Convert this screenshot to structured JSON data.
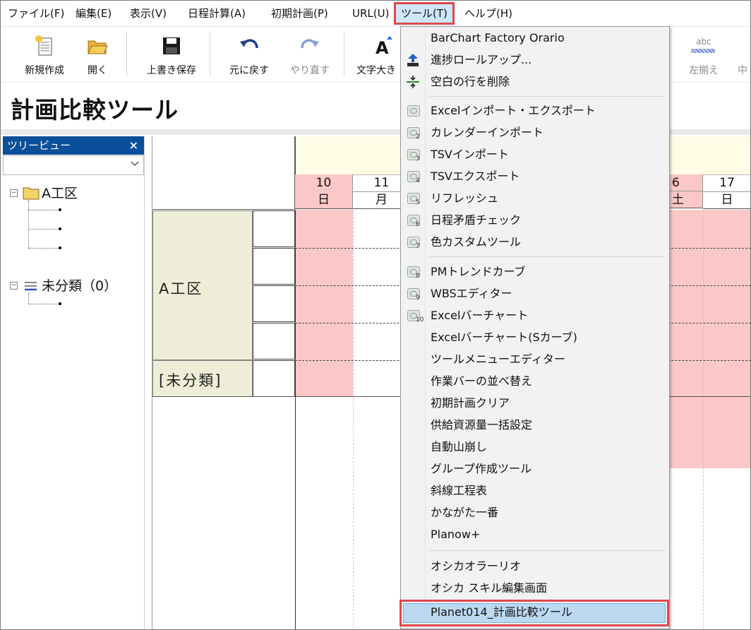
{
  "menubar": [
    {
      "label": "ファイル(F)"
    },
    {
      "label": "編集(E)"
    },
    {
      "label": "表示(V)"
    },
    {
      "label": "日程計算(A)"
    },
    {
      "label": "初期計画(P)"
    },
    {
      "label": "URL(U)"
    },
    {
      "label": "ツール(T)"
    },
    {
      "label": "ヘルプ(H)"
    }
  ],
  "toolbar": {
    "new": "新規作成",
    "open": "開く",
    "save": "上書き保存",
    "undo": "元に戻す",
    "redo": "やり直す",
    "font": "文字大き",
    "align_left_sample": "abc",
    "align_left": "左揃え",
    "align_center": "中"
  },
  "page_title": "計画比較ツール",
  "treeview": {
    "title": "ツリービュー",
    "close": "×",
    "nodes": [
      "A工区",
      "未分類（0）"
    ]
  },
  "gantt": {
    "days": [
      "10",
      "11",
      "6",
      "17"
    ],
    "weekdays": [
      "日",
      "月",
      "土",
      "日"
    ],
    "groups": [
      "A工区",
      "[未分類]"
    ]
  },
  "tools_menu": {
    "items": [
      {
        "label": "BarChart Factory Orario"
      },
      {
        "label": "進捗ロールアップ..."
      },
      {
        "label": "空白の行を削除"
      },
      {
        "label": "Excelインポート・エクスポート",
        "num": ""
      },
      {
        "label": "カレンダーインポート",
        "num": "2"
      },
      {
        "label": "TSVインポート",
        "num": "3"
      },
      {
        "label": "TSVエクスポート",
        "num": "4"
      },
      {
        "label": "リフレッシュ",
        "num": "5"
      },
      {
        "label": "日程矛盾チェック",
        "num": "6"
      },
      {
        "label": "色カスタムツール",
        "num": "7"
      },
      {
        "label": "PMトレンドカーブ",
        "num": "8"
      },
      {
        "label": "WBSエディター",
        "num": "9"
      },
      {
        "label": "Excelバーチャート",
        "num": "10"
      },
      {
        "label": "Excelバーチャート(Sカーブ)"
      },
      {
        "label": "ツールメニューエディター"
      },
      {
        "label": "作業バーの並べ替え"
      },
      {
        "label": "初期計画クリア"
      },
      {
        "label": "供給資源量一括設定"
      },
      {
        "label": "自動山崩し"
      },
      {
        "label": "グループ作成ツール"
      },
      {
        "label": "斜線工程表"
      },
      {
        "label": "かながた一番"
      },
      {
        "label": "Planow+"
      },
      {
        "label": "オシカオラーリオ"
      },
      {
        "label": "オシカ スキル編集画面"
      },
      {
        "label": "Planet014_計画比較ツール"
      }
    ]
  }
}
